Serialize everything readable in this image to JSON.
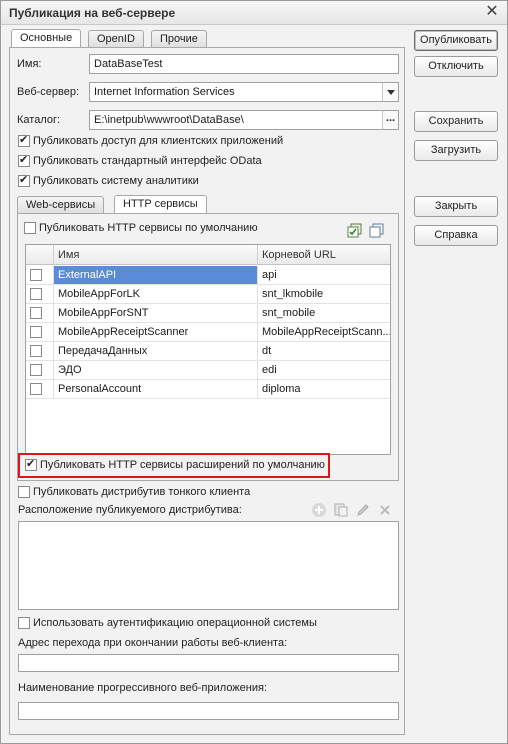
{
  "window": {
    "title": "Публикация на веб-сервере"
  },
  "tabs": [
    "Основные",
    "OpenID",
    "Прочие"
  ],
  "fields": {
    "name_label": "Имя:",
    "name_value": "DataBaseTest",
    "webserver_label": "Веб-сервер:",
    "webserver_value": "Internet Information Services",
    "catalog_label": "Каталог:",
    "catalog_value": "E:\\inetpub\\wwwroot\\DataBase\\",
    "catalog_btn": "..."
  },
  "checks": {
    "client_apps": "Публиковать доступ для клиентских приложений",
    "odata": "Публиковать стандартный интерфейс OData",
    "analytics": "Публиковать систему аналитики"
  },
  "subtabs": [
    "Web-сервисы",
    "HTTP сервисы"
  ],
  "http": {
    "default_label": "Публиковать HTTP сервисы по умолчанию",
    "columns": [
      "Имя",
      "Корневой URL"
    ],
    "rows": [
      {
        "name": "ExternalAPI",
        "url": "api"
      },
      {
        "name": "MobileAppForLK",
        "url": "snt_lkmobile"
      },
      {
        "name": "MobileAppForSNT",
        "url": "snt_mobile"
      },
      {
        "name": "MobileAppReceiptScanner",
        "url": "MobileAppReceiptScann..."
      },
      {
        "name": "ПередачаДанных",
        "url": "dt"
      },
      {
        "name": "ЭДО",
        "url": "edi"
      },
      {
        "name": "PersonalAccount",
        "url": "diploma"
      }
    ],
    "extensions_label": "Публиковать HTTP сервисы расширений по умолчанию"
  },
  "thin_client": {
    "label": "Публиковать дистрибутив тонкого клиента",
    "location_label": "Расположение публикуемого дистрибутива:"
  },
  "os_auth_label": "Использовать аутентификацию операционной системы",
  "redirect_label": "Адрес перехода при окончании работы веб-клиента:",
  "pwa_label": "Наименование прогрессивного веб-приложения:",
  "buttons": {
    "publish": "Опубликовать",
    "disable": "Отключить",
    "save": "Сохранить",
    "load": "Загрузить",
    "close": "Закрыть",
    "help": "Справка"
  },
  "colors": {
    "selection": "#5a8bd8",
    "highlight": "#e0141a"
  }
}
